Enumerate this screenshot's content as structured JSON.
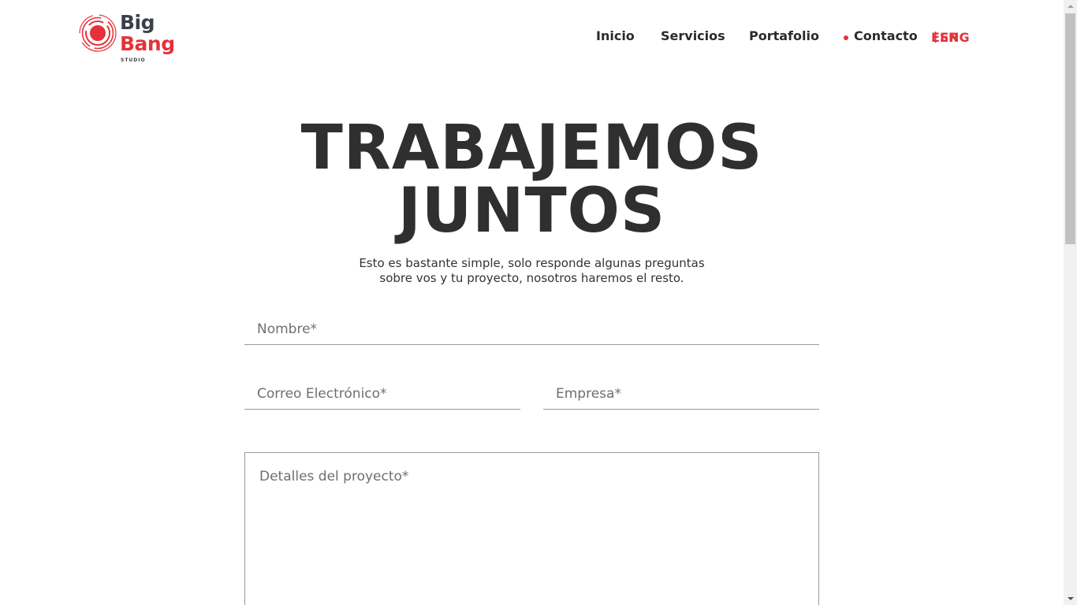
{
  "brand": {
    "line1": "Big",
    "line2": "Bang",
    "tagline": "STUDIO",
    "colors": {
      "dark": "#3a3f4a",
      "accent": "#e5323a"
    }
  },
  "nav": {
    "items": [
      {
        "label": "Inicio",
        "active": false
      },
      {
        "label": "Servicios",
        "active": false
      },
      {
        "label": "Portafolio",
        "active": false
      },
      {
        "label": "Contacto",
        "active": true
      }
    ],
    "lang": {
      "esp": "ESP",
      "separator": "|",
      "eng": "ENG"
    }
  },
  "hero": {
    "title_line1": "TRABAJEMOS",
    "title_line2": "JUNTOS",
    "subtitle_line1": "Esto es bastante simple, solo responde algunas preguntas",
    "subtitle_line2": "sobre vos y tu proyecto, nosotros haremos el resto."
  },
  "form": {
    "name_placeholder": "Nombre*",
    "email_placeholder": "Correo Electrónico*",
    "company_placeholder": "Empresa*",
    "details_placeholder": "Detalles del proyecto*"
  },
  "icons": {
    "logo": "big-bang-logo-icon",
    "active": "active-dot-icon"
  }
}
